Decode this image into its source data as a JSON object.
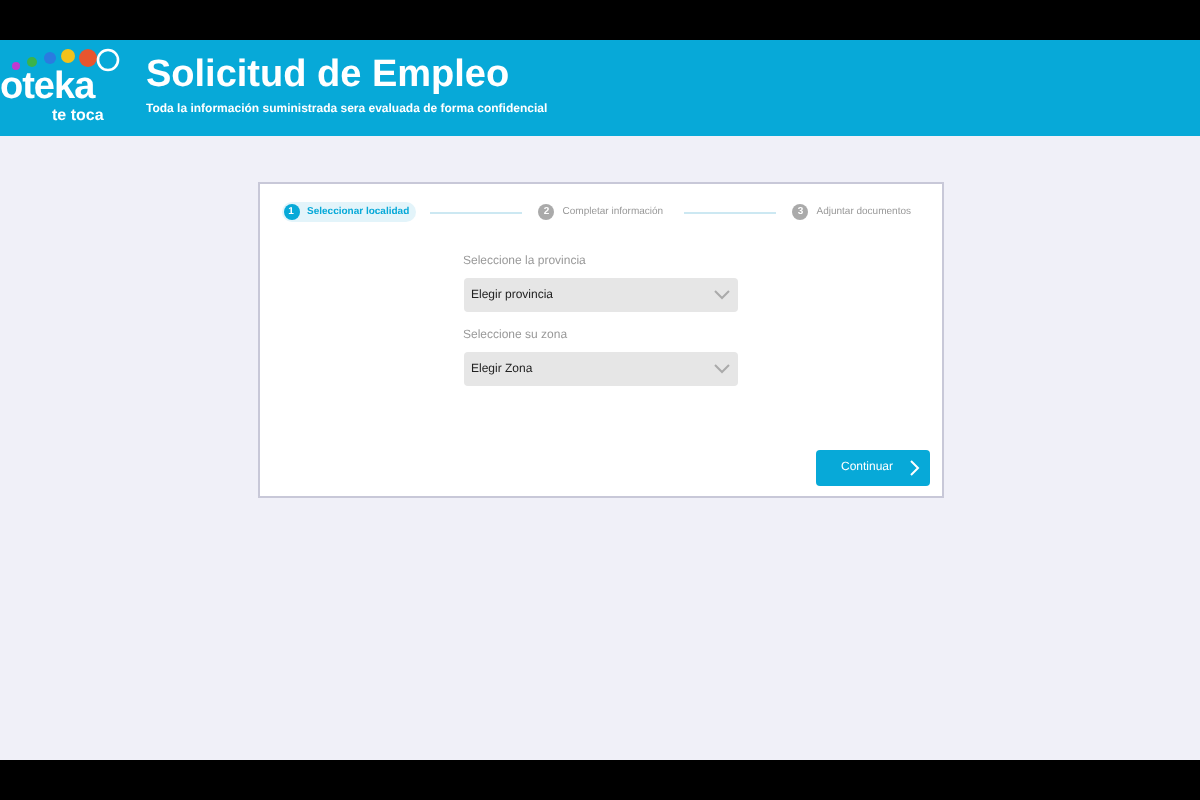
{
  "header": {
    "logo_text": "oteka",
    "logo_subtext": "te toca",
    "title": "Solicitud de Empleo",
    "subtitle": "Toda la información suministrada sera evaluada de forma confidencial"
  },
  "steps": [
    {
      "number": "1",
      "label": "Seleccionar localidad",
      "selected": true
    },
    {
      "number": "2",
      "label": "Completar información",
      "selected": false
    },
    {
      "number": "3",
      "label": "Adjuntar documentos",
      "selected": false
    }
  ],
  "fields": [
    {
      "label": "Seleccione la provincia",
      "value": "Elegir provincia"
    },
    {
      "label": "Seleccione su zona",
      "value": "Elegir Zona"
    }
  ],
  "continue_button": {
    "label": "Continuar"
  }
}
